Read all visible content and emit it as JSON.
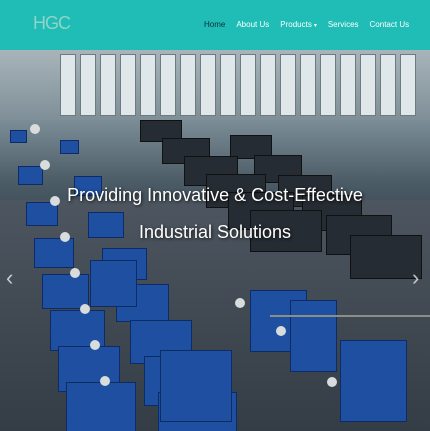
{
  "brand": {
    "logo_text": "HGC"
  },
  "nav": {
    "items": [
      {
        "label": "Home",
        "active": true
      },
      {
        "label": "About Us"
      },
      {
        "label": "Products",
        "caret": "▾"
      },
      {
        "label": "Services"
      },
      {
        "label": "Contact Us"
      }
    ]
  },
  "hero": {
    "headline_line1": "Providing Innovative & Cost-Effective",
    "headline_line2": "Industrial Solutions",
    "prev_icon": "‹",
    "next_icon": "›"
  },
  "colors": {
    "navbar": "#1fbdb6",
    "machine_blue": "#1e4fa0"
  }
}
